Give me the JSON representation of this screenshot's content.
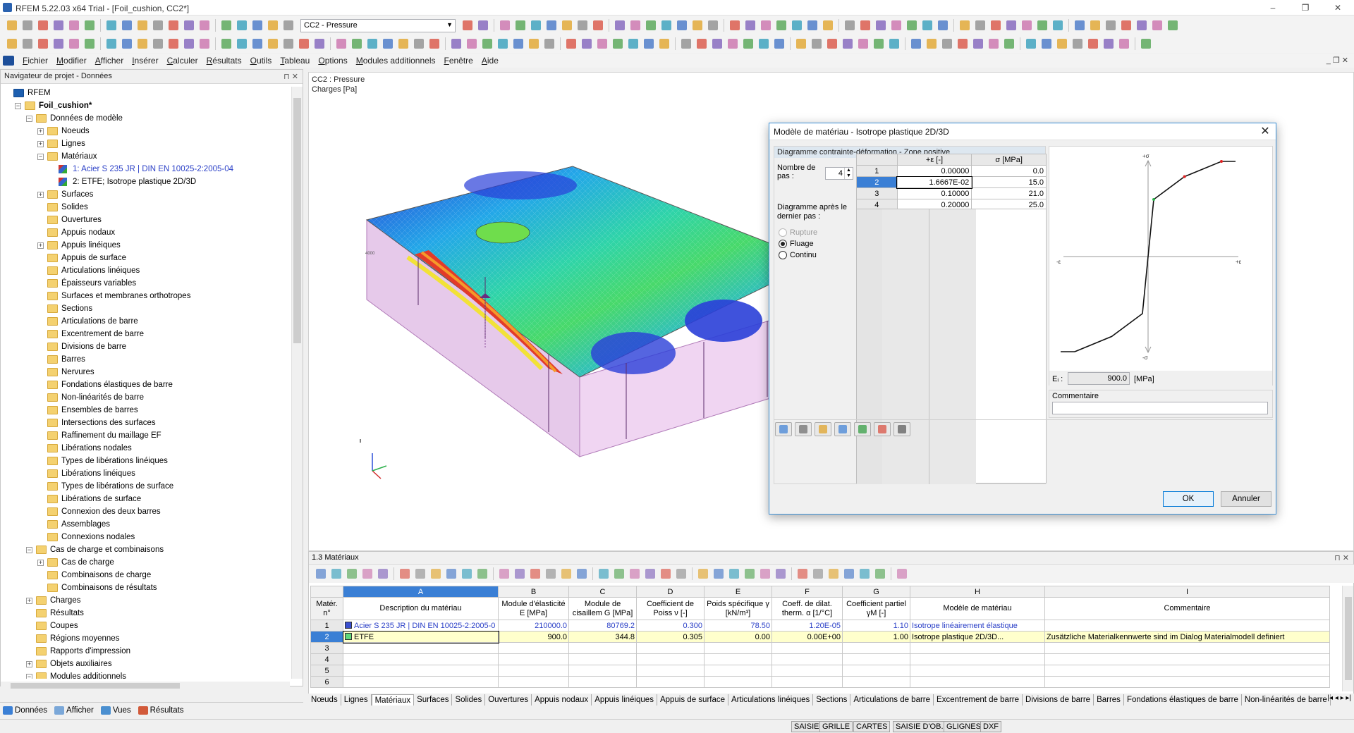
{
  "window": {
    "title": "RFEM 5.22.03 x64 Trial - [Foil_cushion, CC2*]",
    "controls": [
      "–",
      "❐",
      "✕"
    ]
  },
  "toolbar": {
    "load_case": "CC2 - Pressure"
  },
  "menu": [
    "Fichier",
    "Modifier",
    "Afficher",
    "Insérer",
    "Calculer",
    "Résultats",
    "Outils",
    "Tableau",
    "Options",
    "Modules additionnels",
    "Fenêtre",
    "Aide"
  ],
  "navigator": {
    "title": "Navigateur de projet - Données",
    "pin": "⊓ ✕",
    "items": [
      {
        "label": "RFEM",
        "level": 0,
        "icon": "root",
        "exp": ""
      },
      {
        "label": "Foil_cushion*",
        "level": 1,
        "icon": "folder",
        "exp": "−",
        "bold": true
      },
      {
        "label": "Données de modèle",
        "level": 2,
        "icon": "folder",
        "exp": "−"
      },
      {
        "label": "Noeuds",
        "level": 3,
        "icon": "folder",
        "exp": "+"
      },
      {
        "label": "Lignes",
        "level": 3,
        "icon": "folder",
        "exp": "+"
      },
      {
        "label": "Matériaux",
        "level": 3,
        "icon": "folder",
        "exp": "−"
      },
      {
        "label": "1: Acier S 235 JR | DIN EN 10025-2:2005-04",
        "level": 4,
        "icon": "mat",
        "exp": "",
        "blue": true
      },
      {
        "label": "2: ETFE; Isotrope plastique 2D/3D",
        "level": 4,
        "icon": "mat",
        "exp": ""
      },
      {
        "label": "Surfaces",
        "level": 3,
        "icon": "folder",
        "exp": "+"
      },
      {
        "label": "Solides",
        "level": 3,
        "icon": "folder",
        "exp": ""
      },
      {
        "label": "Ouvertures",
        "level": 3,
        "icon": "folder",
        "exp": ""
      },
      {
        "label": "Appuis nodaux",
        "level": 3,
        "icon": "folder",
        "exp": ""
      },
      {
        "label": "Appuis linéiques",
        "level": 3,
        "icon": "folder",
        "exp": "+"
      },
      {
        "label": "Appuis de surface",
        "level": 3,
        "icon": "folder",
        "exp": ""
      },
      {
        "label": "Articulations linéiques",
        "level": 3,
        "icon": "folder",
        "exp": ""
      },
      {
        "label": "Épaisseurs variables",
        "level": 3,
        "icon": "folder",
        "exp": ""
      },
      {
        "label": "Surfaces et membranes orthotropes",
        "level": 3,
        "icon": "folder",
        "exp": ""
      },
      {
        "label": "Sections",
        "level": 3,
        "icon": "folder",
        "exp": ""
      },
      {
        "label": "Articulations de barre",
        "level": 3,
        "icon": "folder",
        "exp": ""
      },
      {
        "label": "Excentrement de barre",
        "level": 3,
        "icon": "folder",
        "exp": ""
      },
      {
        "label": "Divisions de barre",
        "level": 3,
        "icon": "folder",
        "exp": ""
      },
      {
        "label": "Barres",
        "level": 3,
        "icon": "folder",
        "exp": ""
      },
      {
        "label": "Nervures",
        "level": 3,
        "icon": "folder",
        "exp": ""
      },
      {
        "label": "Fondations élastiques de barre",
        "level": 3,
        "icon": "folder",
        "exp": ""
      },
      {
        "label": "Non-linéarités de barre",
        "level": 3,
        "icon": "folder",
        "exp": ""
      },
      {
        "label": "Ensembles de barres",
        "level": 3,
        "icon": "folder",
        "exp": ""
      },
      {
        "label": "Intersections des surfaces",
        "level": 3,
        "icon": "folder",
        "exp": ""
      },
      {
        "label": "Raffinement du maillage EF",
        "level": 3,
        "icon": "folder",
        "exp": ""
      },
      {
        "label": "Libérations nodales",
        "level": 3,
        "icon": "folder",
        "exp": ""
      },
      {
        "label": "Types de libérations linéiques",
        "level": 3,
        "icon": "folder",
        "exp": ""
      },
      {
        "label": "Libérations linéiques",
        "level": 3,
        "icon": "folder",
        "exp": ""
      },
      {
        "label": "Types de libérations de surface",
        "level": 3,
        "icon": "folder",
        "exp": ""
      },
      {
        "label": "Libérations de surface",
        "level": 3,
        "icon": "folder",
        "exp": ""
      },
      {
        "label": "Connexion des deux barres",
        "level": 3,
        "icon": "folder",
        "exp": ""
      },
      {
        "label": "Assemblages",
        "level": 3,
        "icon": "folder",
        "exp": ""
      },
      {
        "label": "Connexions nodales",
        "level": 3,
        "icon": "folder",
        "exp": ""
      },
      {
        "label": "Cas de charge et combinaisons",
        "level": 2,
        "icon": "folder",
        "exp": "−"
      },
      {
        "label": "Cas de charge",
        "level": 3,
        "icon": "folder",
        "exp": "+"
      },
      {
        "label": "Combinaisons de charge",
        "level": 3,
        "icon": "folder",
        "exp": ""
      },
      {
        "label": "Combinaisons de résultats",
        "level": 3,
        "icon": "folder",
        "exp": ""
      },
      {
        "label": "Charges",
        "level": 2,
        "icon": "folder",
        "exp": "+"
      },
      {
        "label": "Résultats",
        "level": 2,
        "icon": "folder",
        "exp": ""
      },
      {
        "label": "Coupes",
        "level": 2,
        "icon": "folder",
        "exp": ""
      },
      {
        "label": "Régions moyennes",
        "level": 2,
        "icon": "folder",
        "exp": ""
      },
      {
        "label": "Rapports d'impression",
        "level": 2,
        "icon": "folder",
        "exp": ""
      },
      {
        "label": "Objets auxiliaires",
        "level": 2,
        "icon": "folder",
        "exp": "+"
      },
      {
        "label": "Modules additionnels",
        "level": 2,
        "icon": "folder",
        "exp": "−"
      }
    ],
    "tabs": [
      {
        "label": "Données",
        "color": "#3a7fd5"
      },
      {
        "label": "Afficher",
        "color": "#7aa7d8"
      },
      {
        "label": "Vues",
        "color": "#4a8fd0"
      },
      {
        "label": "Résultats",
        "color": "#d25a3a"
      }
    ]
  },
  "view": {
    "line1": "CC2 : Pressure",
    "line2": "Charges [Pa]",
    "axis_label": "4000"
  },
  "dialog": {
    "title": "Modèle de matériau - Isotrope plastique 2D/3D",
    "close": "✕",
    "group_title": "Diagramme contrainte-déformation - Zone positive",
    "steps_label": "Nombre de pas :",
    "steps_value": "4",
    "after_label": "Diagramme après le dernier pas :",
    "options": [
      {
        "label": "Rupture",
        "state": "disabled"
      },
      {
        "label": "Fluage",
        "state": "selected"
      },
      {
        "label": "Continu",
        "state": "normal"
      }
    ],
    "table_headers": [
      "",
      "+ε [-]",
      "σ [MPa]"
    ],
    "table_rows": [
      [
        "1",
        "0.00000",
        "0.0"
      ],
      [
        "2",
        "1.6667E-02",
        "15.0"
      ],
      [
        "3",
        "0.10000",
        "21.0"
      ],
      [
        "4",
        "0.20000",
        "25.0"
      ]
    ],
    "chart": {
      "y_pos": "+σ",
      "y_neg": "-σ",
      "x_pos": "+ε",
      "x_neg": "-ε"
    },
    "e_label": "Eᵢ :",
    "e_value": "900.0",
    "e_unit": "[MPa]",
    "comment_label": "Commentaire",
    "comment_value": "",
    "ok": "OK",
    "cancel": "Annuler"
  },
  "table": {
    "title": "1.3 Matériaux",
    "letters": [
      "A",
      "B",
      "C",
      "D",
      "E",
      "F",
      "G",
      "H",
      "I"
    ],
    "header_rn": "Matér. n°",
    "headers": [
      "Description du matériau",
      "Module d'élasticité E [MPa]",
      "Module de cisaillem G [MPa]",
      "Coefficient de Poiss ν [-]",
      "Poids spécifique γ [kN/m³]",
      "Coeff. de dilat. therm. α [1/°C]",
      "Coefficient partiel γM [-]",
      "Modèle de matériau",
      "Commentaire"
    ],
    "rows": [
      {
        "n": "1",
        "desc": "Acier S 235 JR | DIN EN 10025-2:2005-0",
        "E": "210000.0",
        "G": "80769.2",
        "nu": "0.300",
        "gamma": "78.50",
        "alpha": "1.20E-05",
        "gm": "1.10",
        "model": "Isotrope linéairement élastique",
        "comment": "",
        "color": "#3a4fcf"
      },
      {
        "n": "2",
        "desc": "ETFE",
        "E": "900.0",
        "G": "344.8",
        "nu": "0.305",
        "gamma": "0.00",
        "alpha": "0.00E+00",
        "gm": "1.00",
        "model": "Isotrope plastique 2D/3D...",
        "comment": "Zusätzliche Materialkennwerte sind im Dialog Materialmodell definiert",
        "color": "#5fd87a"
      },
      {
        "n": "3"
      },
      {
        "n": "4"
      },
      {
        "n": "5"
      },
      {
        "n": "6"
      }
    ]
  },
  "sheet_tabs": [
    "Nœuds",
    "Lignes",
    "Matériaux",
    "Surfaces",
    "Solides",
    "Ouvertures",
    "Appuis nodaux",
    "Appuis linéiques",
    "Appuis de surface",
    "Articulations linéiques",
    "Sections",
    "Articulations de barre",
    "Excentrement de barre",
    "Divisions de barre",
    "Barres",
    "Fondations élastiques de barre",
    "Non-linéarités de barre"
  ],
  "sheet_active": "Matériaux",
  "status": [
    "SAISIE",
    "GRILLE",
    "CARTES",
    "SAISIE D'OB.",
    "GLIGNES",
    "DXF"
  ]
}
